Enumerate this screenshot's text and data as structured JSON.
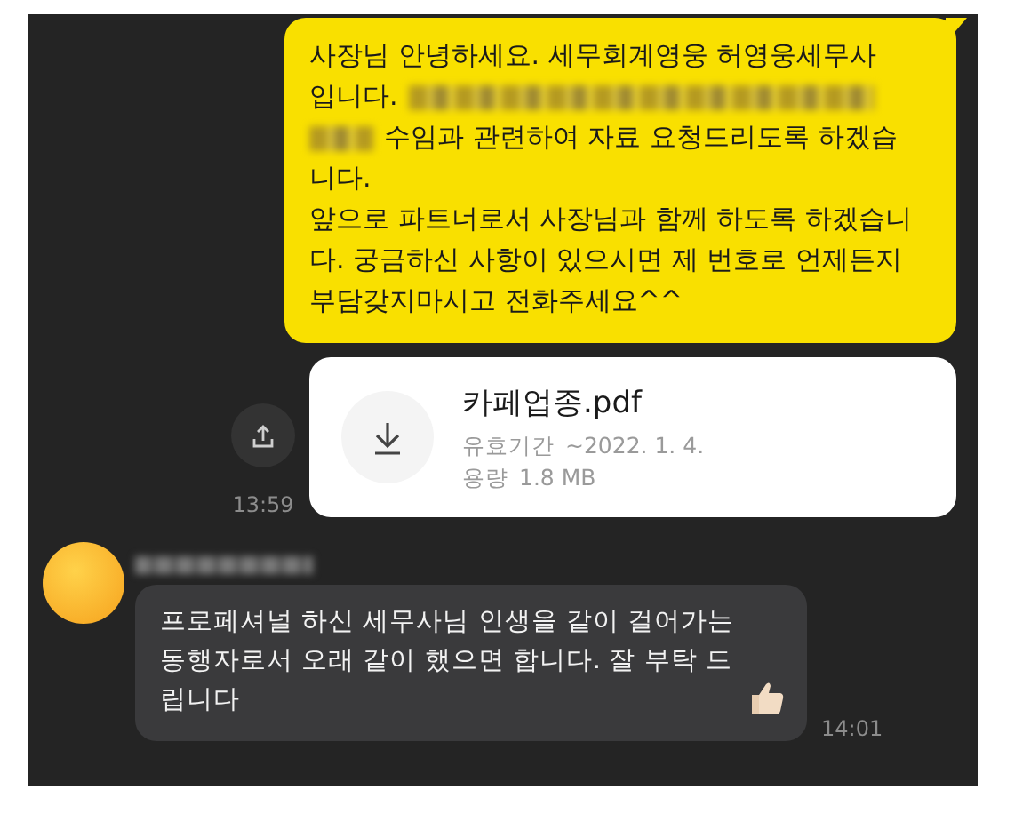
{
  "messages": [
    {
      "kind": "sent_text",
      "lines": [
        [
          {
            "kind": "text",
            "text": "사장님 안녕하세요. 세무회계영웅 허영웅세무사"
          }
        ],
        [
          {
            "kind": "text",
            "text": "입니다."
          },
          {
            "kind": "redacted"
          }
        ],
        [
          {
            "kind": "redacted"
          },
          {
            "kind": "text",
            "text": "수임과 관련하여 자료 요청드리도록 하겠습"
          }
        ],
        [
          {
            "kind": "text",
            "text": "니다.\n앞으로 파트너로서 사장님과 함께 하도록 하겠습니다. 궁금하신 사항이 있으시면 제 번호로 언제든지 부담갖지마시고 전화주세요^^"
          }
        ]
      ]
    },
    {
      "kind": "sent_file",
      "file_name": "카페업종.pdf",
      "validity_label": "유효기간",
      "validity": "~2022. 1. 4.",
      "size_label": "용량",
      "size": "1.8 MB",
      "time": "13:59"
    },
    {
      "kind": "received_text",
      "text": "프로페셔널 하신 세무사님 인생을 같이 걸어가는 동행자로서 오래 같이 했으면 합니다. 잘 부탁 드립니다",
      "time": "14:01"
    }
  ]
}
